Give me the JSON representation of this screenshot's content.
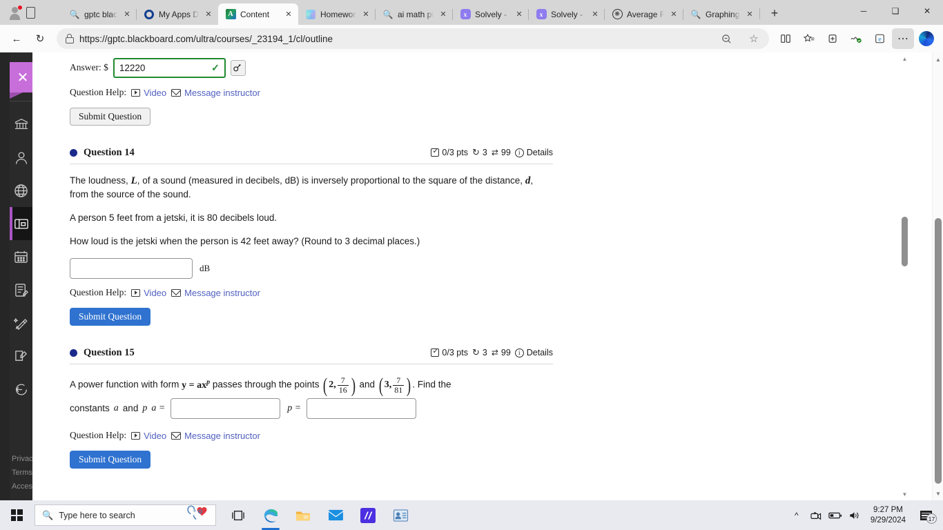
{
  "browser": {
    "tabs": [
      {
        "label": "gptc blackboard",
        "icon": "search-icon",
        "active": false
      },
      {
        "label": "My Apps Dashboard",
        "icon": "microsoft-ring-icon",
        "active": false
      },
      {
        "label": "Content",
        "icon": "blackboard-icon",
        "active": true
      },
      {
        "label": "Homework",
        "icon": "hex-icon",
        "active": false
      },
      {
        "label": "ai math picture",
        "icon": "search-icon",
        "active": false
      },
      {
        "label": "Solvely - Take",
        "icon": "solvely-icon",
        "active": false
      },
      {
        "label": "Solvely - Take",
        "icon": "solvely-icon",
        "active": false
      },
      {
        "label": "Average Rate",
        "icon": "chatgpt-icon",
        "active": false
      },
      {
        "label": "Graphing Tool",
        "icon": "search-icon",
        "active": false
      }
    ],
    "new_tab_label": "+",
    "window_controls": {
      "minimize": "─",
      "maximize": "❐",
      "close": "✕"
    },
    "nav": {
      "back": "←",
      "reload": "↻"
    },
    "url": "https://gptc.blackboard.com/ultra/courses/_23194_1/cl/outline",
    "toolbar_icons": [
      "zoom-out-icon",
      "favorite-star-icon",
      "split-screen-icon",
      "favorites-list-icon",
      "collections-icon",
      "browser-essentials-icon",
      "ie-mode-icon",
      "settings-more-icon",
      "copilot-icon"
    ]
  },
  "sidebar": {
    "close_label": "✕",
    "items": [
      {
        "name": "institution-page"
      },
      {
        "name": "profile"
      },
      {
        "name": "activity-stream"
      },
      {
        "name": "courses",
        "active": true
      },
      {
        "name": "calendar"
      },
      {
        "name": "grades"
      },
      {
        "name": "tools"
      },
      {
        "name": "messages"
      },
      {
        "name": "sign-out"
      }
    ],
    "footer": [
      "Privacy",
      "Terms",
      "Accessibility"
    ]
  },
  "content": {
    "prev_question": {
      "answer_label": "Answer: $",
      "answer_value": "12220",
      "answer_correct_mark": "✓",
      "keyboard_button": "⌨",
      "help_label": "Question Help:",
      "video_link": "Video",
      "message_link": "Message instructor",
      "submit_label": "Submit Question"
    },
    "questions": [
      {
        "title": "Question 14",
        "points": "0/3 pts",
        "attempts": "3",
        "versions": "99",
        "details_label": "Details",
        "body_paragraphs": [
          "The loudness, L, of a sound (measured in decibels, dB) is inversely proportional to the square of the distance, d, from the source of the sound.",
          "A person 5 feet from a jetski, it is 80 decibels loud.",
          "How loud is the jetski when the person is 42 feet away? (Round to 3 decimal places.)"
        ],
        "answer_value": "",
        "unit": "dB",
        "help_label": "Question Help:",
        "video_link": "Video",
        "message_link": "Message instructor",
        "submit_label": "Submit Question"
      },
      {
        "title": "Question 15",
        "points": "0/3 pts",
        "attempts": "3",
        "versions": "99",
        "details_label": "Details",
        "text_before": "A power function with form",
        "formula": "y = ax",
        "formula_exp": "p",
        "text_mid": "passes through the points",
        "point1": {
          "x": "2,",
          "num": "7",
          "den": "16"
        },
        "conjunction": "and",
        "point2": {
          "x": "3,",
          "num": "7",
          "den": "81"
        },
        "text_after": ". Find the",
        "line2_prefix": "constants",
        "var_a": "a",
        "line2_and": "and",
        "var_p": "p",
        "label_a": "a =",
        "label_p": "p =",
        "value_a": "",
        "value_p": "",
        "help_label": "Question Help:",
        "video_link": "Video",
        "message_link": "Message instructor",
        "submit_label": "Submit Question"
      }
    ]
  },
  "taskbar": {
    "search_placeholder": "Type here to search",
    "apps": [
      "task-view-icon",
      "edge-icon",
      "file-explorer-icon",
      "mail-icon",
      "solvely-icon",
      "contacts-icon"
    ],
    "tray_icons": [
      "show-hidden-icons",
      "camera-icon",
      "battery-icon",
      "volume-icon"
    ],
    "time": "9:27 PM",
    "date": "9/29/2024",
    "notification_count": "17"
  }
}
